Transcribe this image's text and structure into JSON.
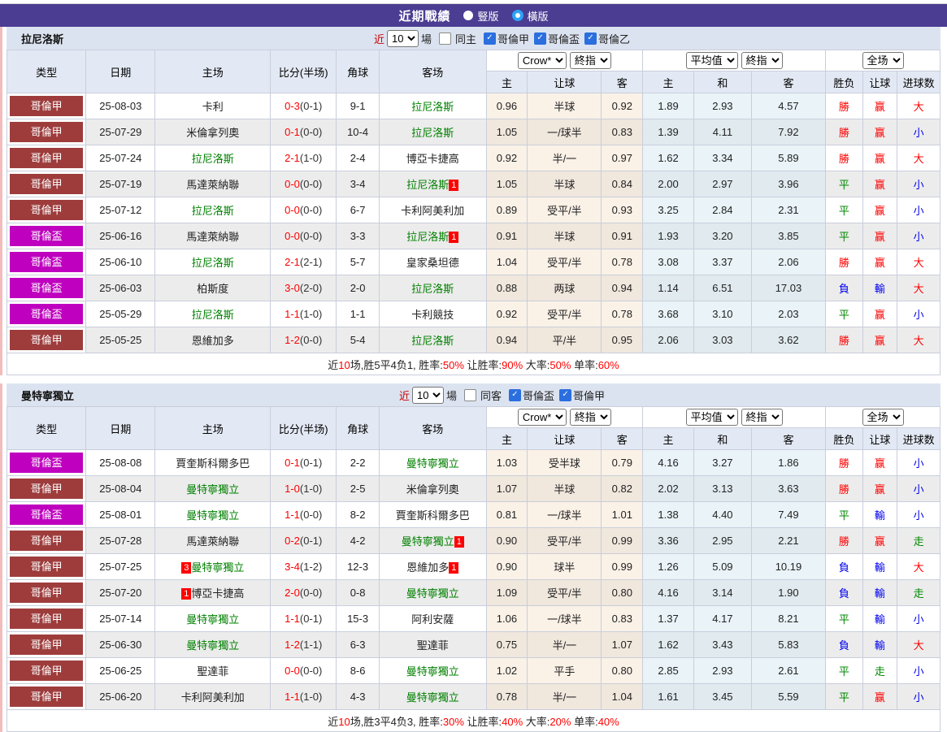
{
  "header": {
    "title": "近期戰績",
    "radio_vertical": "豎版",
    "radio_horizontal": "橫版"
  },
  "controls": {
    "near": "近",
    "select_n": "10",
    "games": "場",
    "crow": "Crow*",
    "final": "終指",
    "average": "平均值",
    "scope": "全场"
  },
  "columns": {
    "type": "类型",
    "date": "日期",
    "home": "主场",
    "score": "比分(半场)",
    "corner": "角球",
    "away": "客场",
    "odds_home": "主",
    "odds_handicap": "让球",
    "odds_away": "客",
    "avg_home": "主",
    "avg_draw": "和",
    "avg_away": "客",
    "result_wdl": "胜负",
    "result_handicap": "让球",
    "result_goals": "进球数"
  },
  "league_colors": {
    "哥倫甲": "#9e3c3c",
    "哥倫盃": "#bf00bf"
  },
  "result_colors": {
    "勝": "#ff0000",
    "赢": "#ff0000",
    "大": "#ff0000",
    "平": "#008800",
    "走": "#008800",
    "負": "#0000ee",
    "輸": "#0000ee",
    "小": "#0000ee"
  },
  "sections": [
    {
      "team": "拉尼洛斯",
      "same_label": "同主",
      "leagues": [
        "哥倫甲",
        "哥倫盃",
        "哥倫乙"
      ],
      "rows": [
        {
          "type": "哥倫甲",
          "date": "25-08-03",
          "home": {
            "name": "卡利"
          },
          "score": {
            "ft": "0-3",
            "ht": "(0-1)"
          },
          "corner": "9-1",
          "away": {
            "name": "拉尼洛斯",
            "green": true
          },
          "odds": [
            "0.96",
            "半球",
            "0.92"
          ],
          "avg": [
            "1.89",
            "2.93",
            "4.57"
          ],
          "results": [
            "勝",
            "赢",
            "大"
          ]
        },
        {
          "type": "哥倫甲",
          "date": "25-07-29",
          "home": {
            "name": "米倫拿列奧"
          },
          "score": {
            "ft": "0-1",
            "ht": "(0-0)"
          },
          "corner": "10-4",
          "away": {
            "name": "拉尼洛斯",
            "green": true
          },
          "odds": [
            "1.05",
            "一/球半",
            "0.83"
          ],
          "avg": [
            "1.39",
            "4.11",
            "7.92"
          ],
          "results": [
            "勝",
            "赢",
            "小"
          ]
        },
        {
          "type": "哥倫甲",
          "date": "25-07-24",
          "home": {
            "name": "拉尼洛斯",
            "green": true
          },
          "score": {
            "ft": "2-1",
            "ht": "(1-0)"
          },
          "corner": "2-4",
          "away": {
            "name": "博亞卡捷高"
          },
          "odds": [
            "0.92",
            "半/一",
            "0.97"
          ],
          "avg": [
            "1.62",
            "3.34",
            "5.89"
          ],
          "results": [
            "勝",
            "赢",
            "大"
          ]
        },
        {
          "type": "哥倫甲",
          "date": "25-07-19",
          "home": {
            "name": "馬達萊納聯"
          },
          "score": {
            "ft": "0-0",
            "ht": "(0-0)"
          },
          "corner": "3-4",
          "away": {
            "name": "拉尼洛斯",
            "green": true,
            "post": "1"
          },
          "odds": [
            "1.05",
            "半球",
            "0.84"
          ],
          "avg": [
            "2.00",
            "2.97",
            "3.96"
          ],
          "results": [
            "平",
            "赢",
            "小"
          ]
        },
        {
          "type": "哥倫甲",
          "date": "25-07-12",
          "home": {
            "name": "拉尼洛斯",
            "green": true
          },
          "score": {
            "ft": "0-0",
            "ht": "(0-0)"
          },
          "corner": "6-7",
          "away": {
            "name": "卡利阿美利加"
          },
          "odds": [
            "0.89",
            "受平/半",
            "0.93"
          ],
          "avg": [
            "3.25",
            "2.84",
            "2.31"
          ],
          "results": [
            "平",
            "赢",
            "小"
          ]
        },
        {
          "type": "哥倫盃",
          "date": "25-06-16",
          "home": {
            "name": "馬達萊納聯"
          },
          "score": {
            "ft": "0-0",
            "ht": "(0-0)"
          },
          "corner": "3-3",
          "away": {
            "name": "拉尼洛斯",
            "green": true,
            "post": "1"
          },
          "odds": [
            "0.91",
            "半球",
            "0.91"
          ],
          "avg": [
            "1.93",
            "3.20",
            "3.85"
          ],
          "results": [
            "平",
            "赢",
            "小"
          ]
        },
        {
          "type": "哥倫盃",
          "date": "25-06-10",
          "home": {
            "name": "拉尼洛斯",
            "green": true
          },
          "score": {
            "ft": "2-1",
            "ht": "(2-1)"
          },
          "corner": "5-7",
          "away": {
            "name": "皇家桑坦德"
          },
          "odds": [
            "1.04",
            "受平/半",
            "0.78"
          ],
          "avg": [
            "3.08",
            "3.37",
            "2.06"
          ],
          "results": [
            "勝",
            "赢",
            "大"
          ]
        },
        {
          "type": "哥倫盃",
          "date": "25-06-03",
          "home": {
            "name": "柏斯度"
          },
          "score": {
            "ft": "3-0",
            "ht": "(2-0)"
          },
          "corner": "2-0",
          "away": {
            "name": "拉尼洛斯",
            "green": true
          },
          "odds": [
            "0.88",
            "两球",
            "0.94"
          ],
          "avg": [
            "1.14",
            "6.51",
            "17.03"
          ],
          "results": [
            "負",
            "輸",
            "大"
          ]
        },
        {
          "type": "哥倫盃",
          "date": "25-05-29",
          "home": {
            "name": "拉尼洛斯",
            "green": true
          },
          "score": {
            "ft": "1-1",
            "ht": "(1-0)"
          },
          "corner": "1-1",
          "away": {
            "name": "卡利競技"
          },
          "odds": [
            "0.92",
            "受平/半",
            "0.78"
          ],
          "avg": [
            "3.68",
            "3.10",
            "2.03"
          ],
          "results": [
            "平",
            "赢",
            "小"
          ]
        },
        {
          "type": "哥倫甲",
          "date": "25-05-25",
          "home": {
            "name": "恩維加多"
          },
          "score": {
            "ft": "1-2",
            "ht": "(0-0)"
          },
          "corner": "5-4",
          "away": {
            "name": "拉尼洛斯",
            "green": true
          },
          "odds": [
            "0.94",
            "平/半",
            "0.95"
          ],
          "avg": [
            "2.06",
            "3.03",
            "3.62"
          ],
          "results": [
            "勝",
            "赢",
            "大"
          ]
        }
      ],
      "summary": [
        [
          "近",
          0
        ],
        [
          "10",
          1
        ],
        [
          "场,胜5平4负1, 胜率:",
          0
        ],
        [
          "50%",
          1
        ],
        [
          " 让胜率:",
          0
        ],
        [
          "90%",
          1
        ],
        [
          " 大率:",
          0
        ],
        [
          "50%",
          1
        ],
        [
          " 单率:",
          0
        ],
        [
          "60%",
          1
        ]
      ]
    },
    {
      "team": "曼特寧獨立",
      "same_label": "同客",
      "leagues": [
        "哥倫盃",
        "哥倫甲"
      ],
      "rows": [
        {
          "type": "哥倫盃",
          "date": "25-08-08",
          "home": {
            "name": "賈奎斯科爾多巴"
          },
          "score": {
            "ft": "0-1",
            "ht": "(0-1)"
          },
          "corner": "2-2",
          "away": {
            "name": "曼特寧獨立",
            "green": true
          },
          "odds": [
            "1.03",
            "受半球",
            "0.79"
          ],
          "avg": [
            "4.16",
            "3.27",
            "1.86"
          ],
          "results": [
            "勝",
            "赢",
            "小"
          ]
        },
        {
          "type": "哥倫甲",
          "date": "25-08-04",
          "home": {
            "name": "曼特寧獨立",
            "green": true
          },
          "score": {
            "ft": "1-0",
            "ht": "(1-0)"
          },
          "corner": "2-5",
          "away": {
            "name": "米倫拿列奧"
          },
          "odds": [
            "1.07",
            "半球",
            "0.82"
          ],
          "avg": [
            "2.02",
            "3.13",
            "3.63"
          ],
          "results": [
            "勝",
            "赢",
            "小"
          ]
        },
        {
          "type": "哥倫盃",
          "date": "25-08-01",
          "home": {
            "name": "曼特寧獨立",
            "green": true
          },
          "score": {
            "ft": "1-1",
            "ht": "(0-0)"
          },
          "corner": "8-2",
          "away": {
            "name": "賈奎斯科爾多巴"
          },
          "odds": [
            "0.81",
            "一/球半",
            "1.01"
          ],
          "avg": [
            "1.38",
            "4.40",
            "7.49"
          ],
          "results": [
            "平",
            "輸",
            "小"
          ]
        },
        {
          "type": "哥倫甲",
          "date": "25-07-28",
          "home": {
            "name": "馬達萊納聯"
          },
          "score": {
            "ft": "0-2",
            "ht": "(0-1)"
          },
          "corner": "4-2",
          "away": {
            "name": "曼特寧獨立",
            "green": true,
            "post": "1"
          },
          "odds": [
            "0.90",
            "受平/半",
            "0.99"
          ],
          "avg": [
            "3.36",
            "2.95",
            "2.21"
          ],
          "results": [
            "勝",
            "赢",
            "走"
          ]
        },
        {
          "type": "哥倫甲",
          "date": "25-07-25",
          "home": {
            "name": "曼特寧獨立",
            "green": true,
            "pre": "3"
          },
          "score": {
            "ft": "3-4",
            "ht": "(1-2)"
          },
          "corner": "12-3",
          "away": {
            "name": "恩維加多",
            "post": "1"
          },
          "odds": [
            "0.90",
            "球半",
            "0.99"
          ],
          "avg": [
            "1.26",
            "5.09",
            "10.19"
          ],
          "results": [
            "負",
            "輸",
            "大"
          ]
        },
        {
          "type": "哥倫甲",
          "date": "25-07-20",
          "home": {
            "name": "博亞卡捷高",
            "pre": "1"
          },
          "score": {
            "ft": "2-0",
            "ht": "(0-0)"
          },
          "corner": "0-8",
          "away": {
            "name": "曼特寧獨立",
            "green": true
          },
          "odds": [
            "1.09",
            "受平/半",
            "0.80"
          ],
          "avg": [
            "4.16",
            "3.14",
            "1.90"
          ],
          "results": [
            "負",
            "輸",
            "走"
          ]
        },
        {
          "type": "哥倫甲",
          "date": "25-07-14",
          "home": {
            "name": "曼特寧獨立",
            "green": true
          },
          "score": {
            "ft": "1-1",
            "ht": "(0-1)"
          },
          "corner": "15-3",
          "away": {
            "name": "阿利安薩"
          },
          "odds": [
            "1.06",
            "一/球半",
            "0.83"
          ],
          "avg": [
            "1.37",
            "4.17",
            "8.21"
          ],
          "results": [
            "平",
            "輸",
            "小"
          ]
        },
        {
          "type": "哥倫甲",
          "date": "25-06-30",
          "home": {
            "name": "曼特寧獨立",
            "green": true
          },
          "score": {
            "ft": "1-2",
            "ht": "(1-1)"
          },
          "corner": "6-3",
          "away": {
            "name": "聖達菲"
          },
          "odds": [
            "0.75",
            "半/一",
            "1.07"
          ],
          "avg": [
            "1.62",
            "3.43",
            "5.83"
          ],
          "results": [
            "負",
            "輸",
            "大"
          ]
        },
        {
          "type": "哥倫甲",
          "date": "25-06-25",
          "home": {
            "name": "聖達菲"
          },
          "score": {
            "ft": "0-0",
            "ht": "(0-0)"
          },
          "corner": "8-6",
          "away": {
            "name": "曼特寧獨立",
            "green": true
          },
          "odds": [
            "1.02",
            "平手",
            "0.80"
          ],
          "avg": [
            "2.85",
            "2.93",
            "2.61"
          ],
          "results": [
            "平",
            "走",
            "小"
          ]
        },
        {
          "type": "哥倫甲",
          "date": "25-06-20",
          "home": {
            "name": "卡利阿美利加"
          },
          "score": {
            "ft": "1-1",
            "ht": "(1-0)"
          },
          "corner": "4-3",
          "away": {
            "name": "曼特寧獨立",
            "green": true
          },
          "odds": [
            "0.78",
            "半/一",
            "1.04"
          ],
          "avg": [
            "1.61",
            "3.45",
            "5.59"
          ],
          "results": [
            "平",
            "赢",
            "小"
          ]
        }
      ],
      "summary": [
        [
          "近",
          0
        ],
        [
          "10",
          1
        ],
        [
          "场,胜3平4负3, 胜率:",
          0
        ],
        [
          "30%",
          1
        ],
        [
          " 让胜率:",
          0
        ],
        [
          "40%",
          1
        ],
        [
          " 大率:",
          0
        ],
        [
          "20%",
          1
        ],
        [
          " 单率:",
          0
        ],
        [
          "40%",
          1
        ]
      ]
    }
  ]
}
